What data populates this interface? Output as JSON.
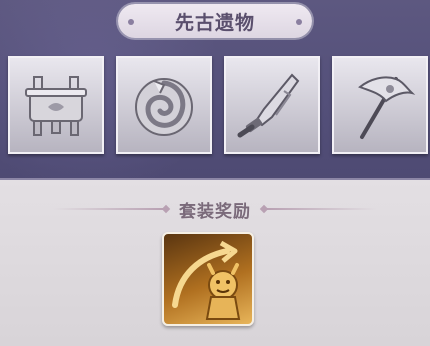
{
  "header": {
    "title": "先古遗物"
  },
  "relics": [
    {
      "name": "ancient-vessel-icon"
    },
    {
      "name": "coiled-dragon-icon"
    },
    {
      "name": "ancient-blade-icon"
    },
    {
      "name": "battle-flag-icon"
    }
  ],
  "set_bonus": {
    "title": "套装奖励",
    "reward_icon": "golden-emblem-icon"
  },
  "colors": {
    "top_panel": "#55507a",
    "bottom_panel": "#dcd8dc",
    "title_text": "#5a4f6d",
    "set_title_text": "#7a6a7a",
    "reward_gold": "#d9a040"
  }
}
